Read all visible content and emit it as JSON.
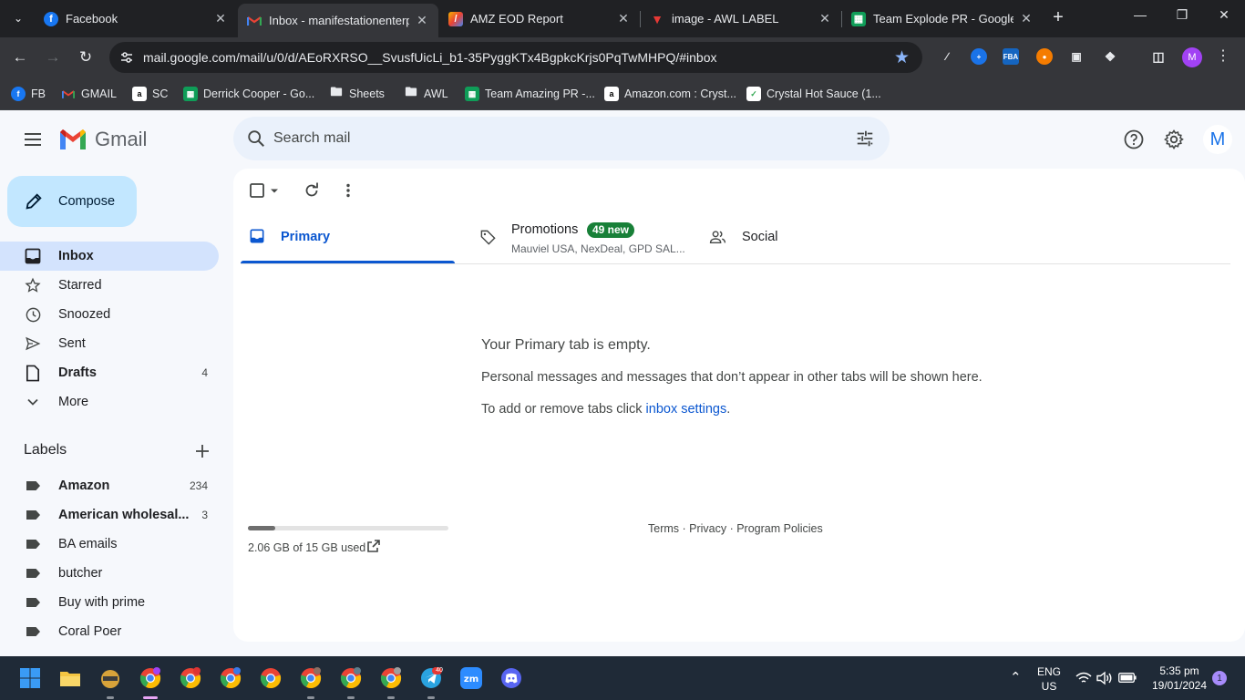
{
  "browser": {
    "tabs": [
      {
        "title": "Facebook",
        "icon": "facebook-icon",
        "active": false
      },
      {
        "title": "Inbox - manifestationenterp",
        "icon": "gmail-icon",
        "active": true
      },
      {
        "title": "AMZ EOD Report",
        "icon": "pencil-color-icon",
        "active": false
      },
      {
        "title": "image - AWL LABEL",
        "icon": "awl-icon",
        "active": false
      },
      {
        "title": "Team Explode PR - Google S",
        "icon": "sheets-icon",
        "active": false
      }
    ],
    "url": "mail.google.com/mail/u/0/d/AEoRXRSO__SvusfUicLi_b1-35PyggKTx4BgpkcKrjs0PqTwMHPQ/#inbox",
    "profile_initial": "M",
    "bookmarks": [
      {
        "label": "FB",
        "icon": "facebook-icon"
      },
      {
        "label": "GMAIL",
        "icon": "gmail-icon"
      },
      {
        "label": "SC",
        "icon": "amazon-icon"
      },
      {
        "label": "Derrick Cooper - Go...",
        "icon": "sheets-icon"
      },
      {
        "label": "Sheets",
        "icon": "folder-icon"
      },
      {
        "label": "AWL",
        "icon": "folder-icon"
      },
      {
        "label": "Team Amazing PR -...",
        "icon": "sheets-icon"
      },
      {
        "label": "Amazon.com : Cryst...",
        "icon": "amazon-icon"
      },
      {
        "label": "Crystal Hot Sauce (1...",
        "icon": "leaf-icon"
      }
    ]
  },
  "gmail": {
    "logo_text": "Gmail",
    "search_placeholder": "Search mail",
    "avatar_initial": "M",
    "compose_label": "Compose",
    "nav": [
      {
        "label": "Inbox",
        "count": "",
        "icon": "inbox-icon"
      },
      {
        "label": "Starred",
        "count": "",
        "icon": "star-icon"
      },
      {
        "label": "Snoozed",
        "count": "",
        "icon": "clock-icon"
      },
      {
        "label": "Sent",
        "count": "",
        "icon": "send-icon"
      },
      {
        "label": "Drafts",
        "count": "4",
        "icon": "draft-icon"
      },
      {
        "label": "More",
        "count": "",
        "icon": "chevron-down-icon"
      }
    ],
    "labels_heading": "Labels",
    "labels": [
      {
        "label": "Amazon",
        "count": "234",
        "bold": true
      },
      {
        "label": "American wholesal...",
        "count": "3",
        "bold": true
      },
      {
        "label": "BA emails",
        "count": "",
        "bold": false
      },
      {
        "label": "butcher",
        "count": "",
        "bold": false
      },
      {
        "label": "Buy with prime",
        "count": "",
        "bold": false
      },
      {
        "label": "Coral Poer",
        "count": "",
        "bold": false
      }
    ],
    "category_tabs": {
      "primary": "Primary",
      "promotions": "Promotions",
      "promotions_badge": "49 new",
      "promotions_sub": "Mauviel USA, NexDeal, GPD SAL...",
      "social": "Social"
    },
    "empty_state": {
      "title": "Your Primary tab is empty.",
      "line1": "Personal messages and messages that don’t appear in other tabs will be shown here.",
      "line2_prefix": "To add or remove tabs click ",
      "line2_link": "inbox settings",
      "line2_suffix": "."
    },
    "storage": {
      "text": "2.06 GB of 15 GB used",
      "fraction": 0.137
    },
    "footer": "Terms · Privacy · Program Policies"
  },
  "taskbar": {
    "lang_line1": "ENG",
    "lang_line2": "US",
    "time": "5:35 pm",
    "date": "19/01/2024",
    "notification_count": "1",
    "telegram_badge": "40"
  },
  "colors": {
    "accent": "#0b57d0",
    "nav_selected": "#d3e3fd",
    "compose_bg": "#c2e7ff",
    "promo_badge": "#188038"
  }
}
